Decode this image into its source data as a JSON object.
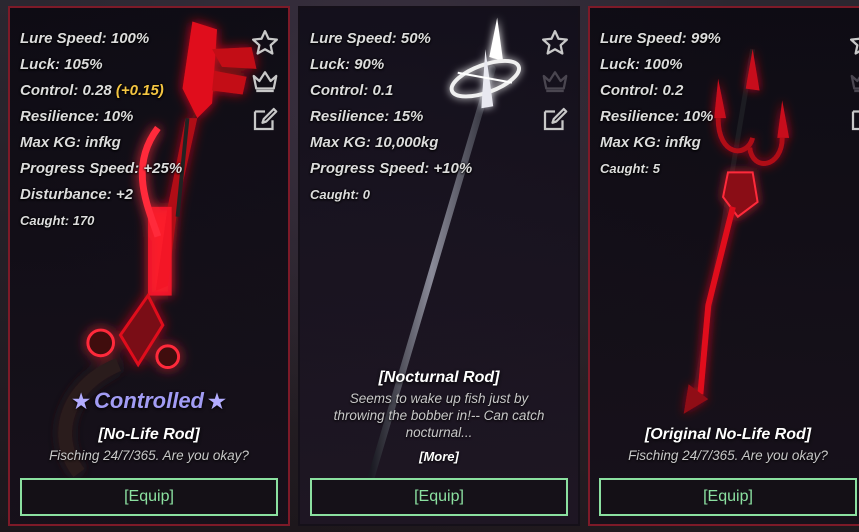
{
  "cards": [
    {
      "stats": [
        {
          "label": "Lure Speed: 100%"
        },
        {
          "label": "Luck: 105%"
        },
        {
          "label": "Control: 0.28",
          "bonus": "(+0.15)"
        },
        {
          "label": "Resilience: 10%"
        },
        {
          "label": "Max KG: infkg"
        },
        {
          "label": "Progress Speed: +25%"
        },
        {
          "label": "Disturbance: +2"
        }
      ],
      "caught": "Caught: 170",
      "enchant": "Controlled",
      "enchant_star": "★",
      "name": "[No-Life Rod]",
      "description": "Fisching 24/7/365. Are you okay?",
      "equip_label": "[Equip]",
      "icons": [
        "star-icon",
        "crown-icon",
        "edit-icon"
      ]
    },
    {
      "stats": [
        {
          "label": "Lure Speed: 50%"
        },
        {
          "label": "Luck: 90%"
        },
        {
          "label": "Control: 0.1"
        },
        {
          "label": "Resilience: 15%"
        },
        {
          "label": "Max KG: 10,000kg"
        },
        {
          "label": "Progress Speed: +10%"
        }
      ],
      "caught": "Caught: 0",
      "name": "[Nocturnal Rod]",
      "description": "Seems to wake up fish just by throwing the bobber in!-- Can catch nocturnal...",
      "more_label": "[More]",
      "equip_label": "[Equip]",
      "icons": [
        "star-icon",
        "crown-icon",
        "edit-icon"
      ]
    },
    {
      "stats": [
        {
          "label": "Lure Speed: 99%"
        },
        {
          "label": "Luck: 100%"
        },
        {
          "label": "Control: 0.2"
        },
        {
          "label": "Resilience: 10%"
        },
        {
          "label": "Max KG: infkg"
        }
      ],
      "caught": "Caught: 5",
      "name": "[Original No-Life Rod]",
      "description": "Fisching 24/7/365. Are you okay?",
      "equip_label": "[Equip]",
      "icons": [
        "star-icon",
        "crown-icon",
        "edit-icon"
      ]
    }
  ],
  "colors": {
    "card_border": "#7d1a28",
    "equip_green": "#8be0a0",
    "bonus_gold": "#f4c542",
    "enchant_purple": "#a29cf4"
  }
}
